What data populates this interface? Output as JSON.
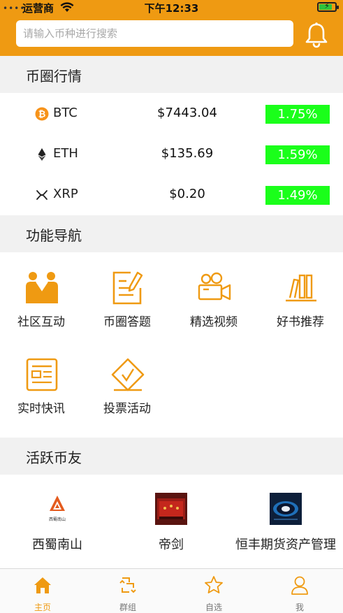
{
  "status_bar": {
    "carrier": "运营商",
    "time": "下午12:33",
    "battery_level": 0.75
  },
  "search": {
    "placeholder": "请输入币种进行搜索"
  },
  "header": {
    "notification_icon": "bell-icon"
  },
  "market": {
    "title": "币圈行情",
    "coins": [
      {
        "symbol": "BTC",
        "price": "$7443.04",
        "change": "1.75%",
        "icon": "bitcoin-icon"
      },
      {
        "symbol": "ETH",
        "price": "$135.69",
        "change": "1.59%",
        "icon": "ethereum-icon"
      },
      {
        "symbol": "XRP",
        "price": "$0.20",
        "change": "1.49%",
        "icon": "xrp-icon"
      }
    ],
    "change_color": "#1aff1a"
  },
  "nav": {
    "title": "功能导航",
    "items": [
      {
        "label": "社区互动",
        "icon": "community-icon"
      },
      {
        "label": "币圈答题",
        "icon": "quiz-icon"
      },
      {
        "label": "精选视频",
        "icon": "video-icon"
      },
      {
        "label": "好书推荐",
        "icon": "books-icon"
      },
      {
        "label": "实时快讯",
        "icon": "news-icon"
      },
      {
        "label": "投票活动",
        "icon": "vote-icon"
      }
    ]
  },
  "friends": {
    "title": "活跃币友",
    "items": [
      {
        "name": "西蜀南山",
        "logo_text": "西蜀南山"
      },
      {
        "name": "帝剑"
      },
      {
        "name": "恒丰期货资产管理"
      }
    ]
  },
  "tabbar": {
    "tabs": [
      {
        "label": "主页",
        "icon": "home-icon",
        "active": true
      },
      {
        "label": "群组",
        "icon": "group-icon",
        "active": false
      },
      {
        "label": "自选",
        "icon": "star-icon",
        "active": false
      },
      {
        "label": "我",
        "icon": "user-icon",
        "active": false
      }
    ]
  },
  "colors": {
    "brand": "#ef9a12",
    "positive": "#1aff1a"
  }
}
